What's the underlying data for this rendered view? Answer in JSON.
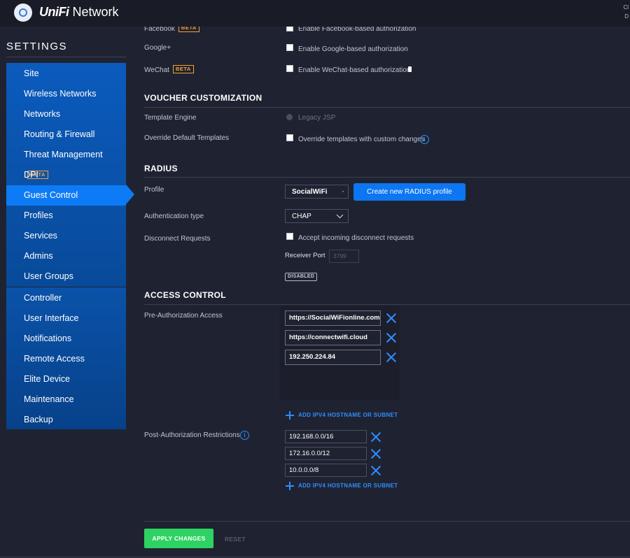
{
  "header": {
    "brand_a": "UniFi",
    "brand_b": "Network",
    "corner_top": "Cl",
    "corner_bottom": "D"
  },
  "sidebar": {
    "title": "SETTINGS",
    "beta": "BETA",
    "group1": [
      {
        "label": "Site"
      },
      {
        "label": "Wireless Networks"
      },
      {
        "label": "Networks"
      },
      {
        "label": "Routing & Firewall"
      },
      {
        "label": "Threat Management",
        "badge": "BETA"
      },
      {
        "label": "DPI"
      },
      {
        "label": "Guest Control",
        "active": true
      },
      {
        "label": "Profiles"
      },
      {
        "label": "Services"
      },
      {
        "label": "Admins"
      },
      {
        "label": "User Groups"
      }
    ],
    "group2": [
      {
        "label": "Controller"
      },
      {
        "label": "User Interface"
      },
      {
        "label": "Notifications"
      },
      {
        "label": "Remote Access"
      },
      {
        "label": "Elite Device"
      },
      {
        "label": "Maintenance"
      },
      {
        "label": "Backup"
      }
    ]
  },
  "auth": {
    "facebook": {
      "label": "Facebook",
      "badge": "BETA",
      "option": "Enable Facebook-based authorization"
    },
    "google": {
      "label": "Google+",
      "option": "Enable Google-based authorization"
    },
    "wechat": {
      "label": "WeChat",
      "badge": "BETA",
      "option": "Enable WeChat-based authorization"
    }
  },
  "voucher": {
    "title": "VOUCHER CUSTOMIZATION",
    "template_engine_label": "Template Engine",
    "template_engine_value": "Legacy JSP",
    "override_label": "Override Default Templates",
    "override_option": "Override templates with custom changes"
  },
  "radius": {
    "title": "RADIUS",
    "profile_label": "Profile",
    "profile_value": "SocialWiFi",
    "create_button": "Create new RADIUS profile",
    "auth_type_label": "Authentication type",
    "auth_type_value": "CHAP",
    "disconnect_label": "Disconnect Requests",
    "disconnect_option": "Accept incoming disconnect requests",
    "receiver_port_label": "Receiver Port",
    "receiver_port_value": "3799",
    "status_badge": "DISABLED"
  },
  "access": {
    "title": "ACCESS CONTROL",
    "pre_label": "Pre-Authorization Access",
    "pre_entries": [
      "https://SocialWiFionline.com",
      "https://connectwifi.cloud",
      "192.250.224.84"
    ],
    "add_link": "ADD IPV4 HOSTNAME OR SUBNET",
    "post_label": "Post-Authorization Restrictions",
    "post_entries": [
      "192.168.0.0/16",
      "172.16.0.0/12",
      "10.0.0.0/8"
    ]
  },
  "footer": {
    "apply": "APPLY CHANGES",
    "reset": "RESET"
  }
}
